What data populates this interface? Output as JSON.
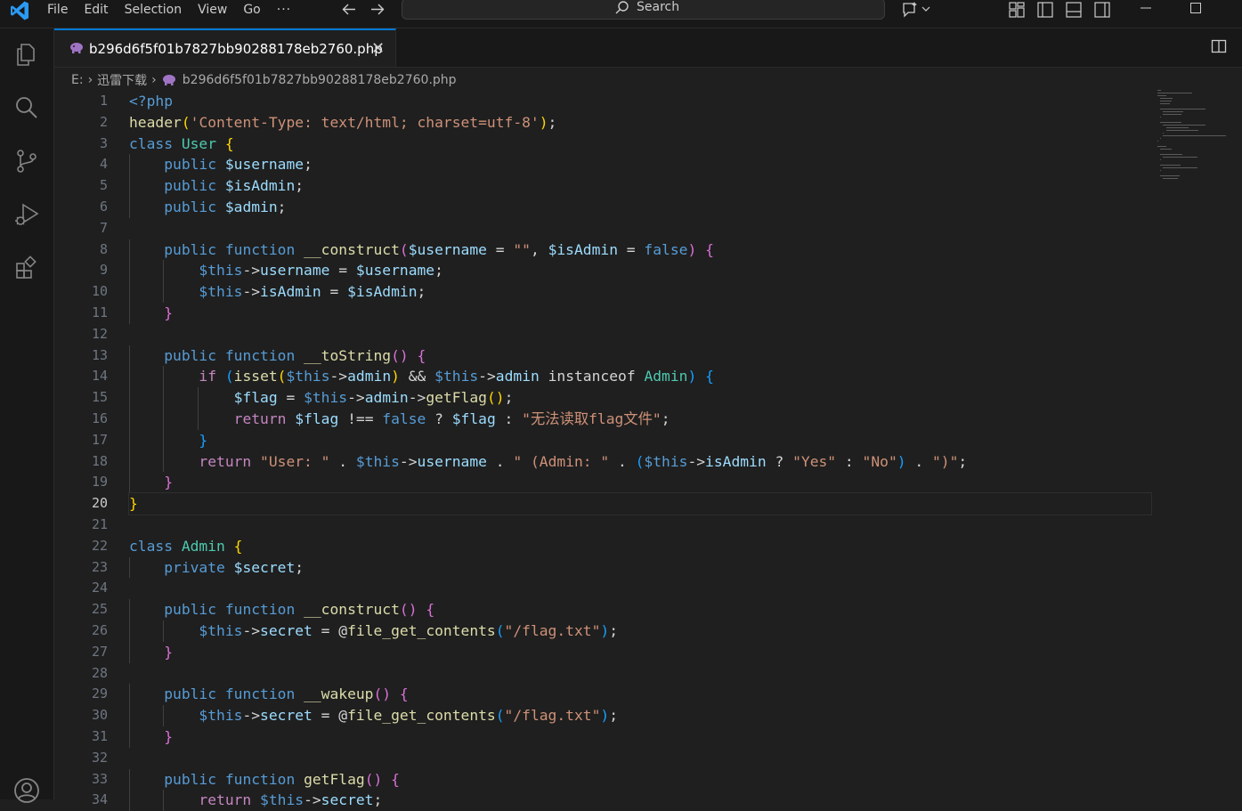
{
  "menu": [
    "File",
    "Edit",
    "Selection",
    "View",
    "Go",
    "···"
  ],
  "search": {
    "label": "Search",
    "icon": "search-icon"
  },
  "tab": {
    "filename": "b296d6f5f01b7827bb90288178eb2760.php",
    "close_glyph": "✕",
    "icon": "php-elephant-icon"
  },
  "breadcrumb": {
    "drive": "E:",
    "folder": "迅雷下载",
    "file": "b296d6f5f01b7827bb90288178eb2760.php"
  },
  "editor": {
    "current_line": 20,
    "line_numbers": [
      "1",
      "2",
      "3",
      "4",
      "5",
      "6",
      "7",
      "8",
      "9",
      "10",
      "11",
      "12",
      "13",
      "14",
      "15",
      "16",
      "17",
      "18",
      "19",
      "20",
      "21",
      "22",
      "23",
      "24",
      "25",
      "26",
      "27",
      "28",
      "29",
      "30",
      "31",
      "32",
      "33",
      "34"
    ],
    "lines": [
      [
        [
          "kw",
          "<?php"
        ]
      ],
      [
        [
          "fn",
          "header"
        ],
        [
          "b1",
          "("
        ],
        [
          "str",
          "'Content-Type: text/html; charset=utf-8'"
        ],
        [
          "b1",
          ")"
        ],
        [
          "p",
          ";"
        ]
      ],
      [
        [
          "kw",
          "class "
        ],
        [
          "cls",
          "User"
        ],
        [
          "p",
          " "
        ],
        [
          "b1",
          "{"
        ]
      ],
      [
        [
          "p",
          "    "
        ],
        [
          "kw",
          "public "
        ],
        [
          "var",
          "$username"
        ],
        [
          "p",
          ";"
        ]
      ],
      [
        [
          "p",
          "    "
        ],
        [
          "kw",
          "public "
        ],
        [
          "var",
          "$isAdmin"
        ],
        [
          "p",
          ";"
        ]
      ],
      [
        [
          "p",
          "    "
        ],
        [
          "kw",
          "public "
        ],
        [
          "var",
          "$admin"
        ],
        [
          "p",
          ";"
        ]
      ],
      [],
      [
        [
          "p",
          "    "
        ],
        [
          "kw",
          "public function "
        ],
        [
          "fn",
          "__construct"
        ],
        [
          "b2",
          "("
        ],
        [
          "var",
          "$username"
        ],
        [
          "p",
          " = "
        ],
        [
          "str",
          "\"\""
        ],
        [
          "p",
          ", "
        ],
        [
          "var",
          "$isAdmin"
        ],
        [
          "p",
          " = "
        ],
        [
          "kw",
          "false"
        ],
        [
          "b2",
          ")"
        ],
        [
          "p",
          " "
        ],
        [
          "b2",
          "{"
        ]
      ],
      [
        [
          "p",
          "        "
        ],
        [
          "th",
          "$this"
        ],
        [
          "p",
          "->"
        ],
        [
          "var",
          "username"
        ],
        [
          "p",
          " = "
        ],
        [
          "var",
          "$username"
        ],
        [
          "p",
          ";"
        ]
      ],
      [
        [
          "p",
          "        "
        ],
        [
          "th",
          "$this"
        ],
        [
          "p",
          "->"
        ],
        [
          "var",
          "isAdmin"
        ],
        [
          "p",
          " = "
        ],
        [
          "var",
          "$isAdmin"
        ],
        [
          "p",
          ";"
        ]
      ],
      [
        [
          "p",
          "    "
        ],
        [
          "b2",
          "}"
        ]
      ],
      [],
      [
        [
          "p",
          "    "
        ],
        [
          "kw",
          "public function "
        ],
        [
          "fn",
          "__toString"
        ],
        [
          "b2",
          "()"
        ],
        [
          "p",
          " "
        ],
        [
          "b2",
          "{"
        ]
      ],
      [
        [
          "p",
          "        "
        ],
        [
          "ctl",
          "if"
        ],
        [
          "p",
          " "
        ],
        [
          "b3",
          "("
        ],
        [
          "fn",
          "isset"
        ],
        [
          "b1",
          "("
        ],
        [
          "th",
          "$this"
        ],
        [
          "p",
          "->"
        ],
        [
          "var",
          "admin"
        ],
        [
          "b1",
          ")"
        ],
        [
          "p",
          " && "
        ],
        [
          "th",
          "$this"
        ],
        [
          "p",
          "->"
        ],
        [
          "var",
          "admin"
        ],
        [
          "p",
          " instanceof "
        ],
        [
          "cls",
          "Admin"
        ],
        [
          "b3",
          ")"
        ],
        [
          "p",
          " "
        ],
        [
          "b3",
          "{"
        ]
      ],
      [
        [
          "p",
          "            "
        ],
        [
          "var",
          "$flag"
        ],
        [
          "p",
          " = "
        ],
        [
          "th",
          "$this"
        ],
        [
          "p",
          "->"
        ],
        [
          "var",
          "admin"
        ],
        [
          "p",
          "->"
        ],
        [
          "fn",
          "getFlag"
        ],
        [
          "b1",
          "()"
        ],
        [
          "p",
          ";"
        ]
      ],
      [
        [
          "p",
          "            "
        ],
        [
          "ctl",
          "return "
        ],
        [
          "var",
          "$flag"
        ],
        [
          "p",
          " !== "
        ],
        [
          "kw",
          "false"
        ],
        [
          "p",
          " ? "
        ],
        [
          "var",
          "$flag"
        ],
        [
          "p",
          " : "
        ],
        [
          "str",
          "\"无法读取flag文件\""
        ],
        [
          "p",
          ";"
        ]
      ],
      [
        [
          "p",
          "        "
        ],
        [
          "b3",
          "}"
        ]
      ],
      [
        [
          "p",
          "        "
        ],
        [
          "ctl",
          "return "
        ],
        [
          "str",
          "\"User: \""
        ],
        [
          "p",
          " . "
        ],
        [
          "th",
          "$this"
        ],
        [
          "p",
          "->"
        ],
        [
          "var",
          "username"
        ],
        [
          "p",
          " . "
        ],
        [
          "str",
          "\" (Admin: \""
        ],
        [
          "p",
          " . "
        ],
        [
          "b3",
          "("
        ],
        [
          "th",
          "$this"
        ],
        [
          "p",
          "->"
        ],
        [
          "var",
          "isAdmin"
        ],
        [
          "p",
          " ? "
        ],
        [
          "str",
          "\"Yes\""
        ],
        [
          "p",
          " : "
        ],
        [
          "str",
          "\"No\""
        ],
        [
          "b3",
          ")"
        ],
        [
          "p",
          " . "
        ],
        [
          "str",
          "\")\""
        ],
        [
          "p",
          ";"
        ]
      ],
      [
        [
          "p",
          "    "
        ],
        [
          "b2",
          "}"
        ]
      ],
      [
        [
          "b1",
          "}"
        ]
      ],
      [],
      [
        [
          "kw",
          "class "
        ],
        [
          "cls",
          "Admin"
        ],
        [
          "p",
          " "
        ],
        [
          "b1",
          "{"
        ]
      ],
      [
        [
          "p",
          "    "
        ],
        [
          "kw",
          "private "
        ],
        [
          "var",
          "$secret"
        ],
        [
          "p",
          ";"
        ]
      ],
      [],
      [
        [
          "p",
          "    "
        ],
        [
          "kw",
          "public function "
        ],
        [
          "fn",
          "__construct"
        ],
        [
          "b2",
          "()"
        ],
        [
          "p",
          " "
        ],
        [
          "b2",
          "{"
        ]
      ],
      [
        [
          "p",
          "        "
        ],
        [
          "th",
          "$this"
        ],
        [
          "p",
          "->"
        ],
        [
          "var",
          "secret"
        ],
        [
          "p",
          " = @"
        ],
        [
          "fn",
          "file_get_contents"
        ],
        [
          "b3",
          "("
        ],
        [
          "str",
          "\"/flag.txt\""
        ],
        [
          "b3",
          ")"
        ],
        [
          "p",
          ";"
        ]
      ],
      [
        [
          "p",
          "    "
        ],
        [
          "b2",
          "}"
        ]
      ],
      [],
      [
        [
          "p",
          "    "
        ],
        [
          "kw",
          "public function "
        ],
        [
          "fn",
          "__wakeup"
        ],
        [
          "b2",
          "()"
        ],
        [
          "p",
          " "
        ],
        [
          "b2",
          "{"
        ]
      ],
      [
        [
          "p",
          "        "
        ],
        [
          "th",
          "$this"
        ],
        [
          "p",
          "->"
        ],
        [
          "var",
          "secret"
        ],
        [
          "p",
          " = @"
        ],
        [
          "fn",
          "file_get_contents"
        ],
        [
          "b3",
          "("
        ],
        [
          "str",
          "\"/flag.txt\""
        ],
        [
          "b3",
          ")"
        ],
        [
          "p",
          ";"
        ]
      ],
      [
        [
          "p",
          "    "
        ],
        [
          "b2",
          "}"
        ]
      ],
      [],
      [
        [
          "p",
          "    "
        ],
        [
          "kw",
          "public function "
        ],
        [
          "fn",
          "getFlag"
        ],
        [
          "b2",
          "()"
        ],
        [
          "p",
          " "
        ],
        [
          "b2",
          "{"
        ]
      ],
      [
        [
          "p",
          "        "
        ],
        [
          "ctl",
          "return "
        ],
        [
          "th",
          "$this"
        ],
        [
          "p",
          "->"
        ],
        [
          "var",
          "secret"
        ],
        [
          "p",
          ";"
        ]
      ]
    ]
  },
  "icons": {
    "activity": [
      "explorer-icon",
      "search-icon",
      "source-control-icon",
      "run-debug-icon",
      "extensions-icon",
      "accounts-icon"
    ],
    "window": [
      "minimize-icon",
      "maximize-icon"
    ]
  },
  "colors": {
    "accent": "#0078d4",
    "background": "#1f1f1f"
  }
}
